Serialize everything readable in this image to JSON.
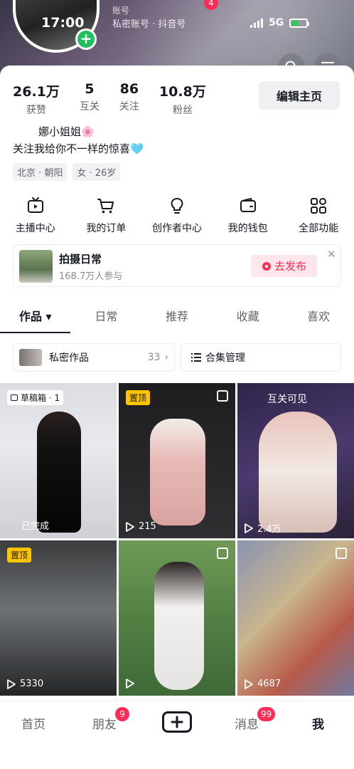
{
  "status_bar": {
    "time": "17:00",
    "network": "5G",
    "signal_icon": "signal-icon",
    "battery_icon": "battery-charging-icon"
  },
  "header": {
    "account_label": "账号",
    "account_sub": "私密账号 · 抖音号",
    "notification_count": "4",
    "search_icon": "search-icon",
    "menu_icon": "menu-icon"
  },
  "profile": {
    "stats": [
      {
        "value": "26.1万",
        "label": "获赞"
      },
      {
        "value": "5",
        "label": "互关"
      },
      {
        "value": "86",
        "label": "关注"
      },
      {
        "value": "10.8万",
        "label": "粉丝"
      }
    ],
    "edit_label": "编辑主页",
    "nickname": "娜小姐姐🌸",
    "bio": "关注我给你不一样的惊喜🩵",
    "tags": [
      "北京 · 朝阳",
      "女 · 26岁"
    ]
  },
  "tools": [
    {
      "icon": "live-tv-icon",
      "label": "主播中心"
    },
    {
      "icon": "cart-icon",
      "label": "我的订单"
    },
    {
      "icon": "lightbulb-icon",
      "label": "创作者中心"
    },
    {
      "icon": "wallet-icon",
      "label": "我的钱包"
    },
    {
      "icon": "grid-apps-icon",
      "label": "全部功能"
    }
  ],
  "promo": {
    "title": "拍摄日常",
    "subtitle": "168.7万人参与",
    "button_label": "去发布",
    "close_icon": "close-icon"
  },
  "tabs": [
    {
      "label": "作品 ▾",
      "active": true
    },
    {
      "label": "日常",
      "active": false
    },
    {
      "label": "推荐",
      "active": false
    },
    {
      "label": "收藏",
      "active": false
    },
    {
      "label": "喜欢",
      "active": false
    }
  ],
  "folders": {
    "private_label": "私密作品",
    "private_count": "33",
    "collection_label": "合集管理"
  },
  "grid": [
    {
      "badge": "草稿箱 · 1",
      "status": "已完成",
      "plays": "",
      "pinned": false,
      "mutual": "",
      "colors": [
        "#dcdde2",
        "#1a1a1e",
        "#f2f2f4"
      ]
    },
    {
      "badge": "置顶",
      "status": "",
      "plays": "215",
      "pinned": true,
      "mutual": "",
      "colors": [
        "#2a2a2c",
        "#e8b9b6",
        "#4a4648"
      ]
    },
    {
      "badge": "",
      "status": "",
      "plays": "2.4万",
      "pinned": false,
      "mutual": "互关可见",
      "colors": [
        "#3b2f5a",
        "#e9c3bd",
        "#6b5a86"
      ]
    },
    {
      "badge": "置顶",
      "status": "",
      "plays": "5330",
      "pinned": true,
      "mutual": "",
      "colors": [
        "#2a2c2e",
        "#8a8c8e",
        "#1d1f21"
      ]
    },
    {
      "badge": "",
      "status": "",
      "plays": "",
      "pinned": false,
      "mutual": "",
      "colors": [
        "#5f8a4a",
        "#f2f0ee",
        "#3f6a38"
      ]
    },
    {
      "badge": "",
      "status": "",
      "plays": "4687",
      "pinned": false,
      "mutual": "",
      "colors": [
        "#6f7aa0",
        "#e6c7a0",
        "#c23a3a"
      ]
    }
  ],
  "bottom_nav": {
    "home": "首页",
    "friends": "朋友",
    "friends_badge": "9",
    "messages": "消息",
    "messages_badge": "99",
    "me": "我"
  }
}
